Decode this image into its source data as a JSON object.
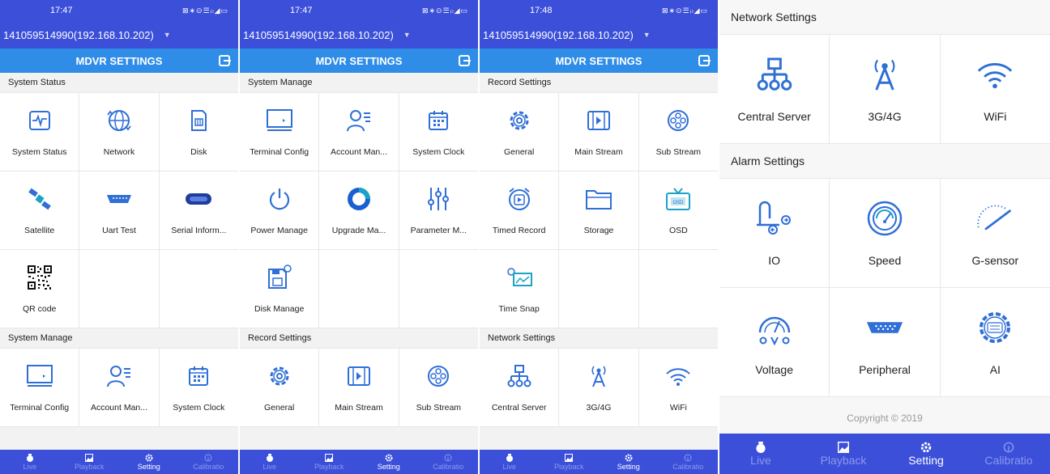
{
  "statusbar": {
    "time_a": "17:47",
    "time_b": "17:47",
    "time_c": "17:48",
    "icons": "⊠∗⊙☰ᵢₗ◢▭"
  },
  "header": {
    "device": "141059514990(192.168.10.202)",
    "title": "MDVR SETTINGS"
  },
  "sections": {
    "system_status": "System Status",
    "system_manage": "System Manage",
    "record_settings": "Record Settings",
    "network_settings": "Network Settings",
    "alarm_settings": "Alarm Settings"
  },
  "tiles": {
    "system_status": "System Status",
    "network": "Network",
    "disk": "Disk",
    "satellite": "Satellite",
    "uart_test": "Uart Test",
    "serial_info": "Serial Inform...",
    "qr_code": "QR code",
    "terminal_config": "Terminal Config",
    "account_man": "Account Man...",
    "system_clock": "System Clock",
    "power_manage": "Power Manage",
    "upgrade_ma": "Upgrade Ma...",
    "parameter_m": "Parameter M...",
    "disk_manage": "Disk Manage",
    "general": "General",
    "main_stream": "Main Stream",
    "sub_stream": "Sub Stream",
    "timed_record": "Timed Record",
    "storage": "Storage",
    "osd": "OSD",
    "time_snap": "Time Snap",
    "central_server": "Central Server",
    "net_3g4g": "3G/4G",
    "wifi": "WiFi",
    "io": "IO",
    "speed": "Speed",
    "g_sensor": "G-sensor",
    "voltage": "Voltage",
    "peripheral": "Peripheral",
    "ai": "AI"
  },
  "navbar": {
    "live": "Live",
    "playback": "Playback",
    "setting": "Setting",
    "calibration": "Calibratio"
  },
  "footer": {
    "copyright": "Copyright © 2019"
  },
  "colors": {
    "primary": "#3b4fd9",
    "title_bar": "#2f8de8",
    "icon_blue": "#2f6fd6",
    "icon_teal": "#1aa3c7"
  }
}
